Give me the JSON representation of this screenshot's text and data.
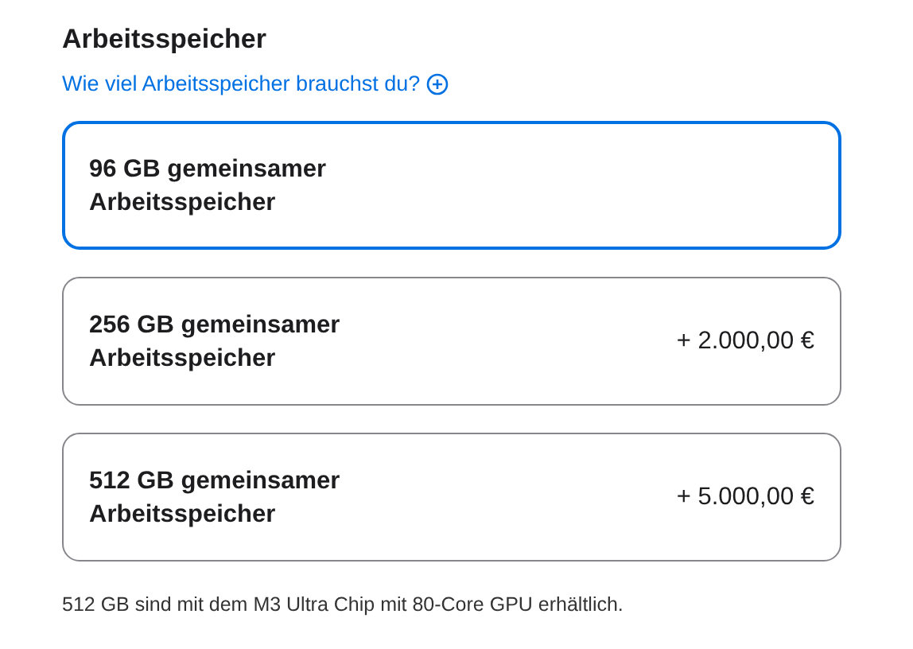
{
  "heading": "Arbeitsspeicher",
  "help_link": {
    "label": "Wie viel Arbeitsspeicher brauchst du?"
  },
  "options": [
    {
      "name": "96 GB gemeinsamer Arbeitsspeicher",
      "selected": true
    },
    {
      "name": "256 GB gemeinsamer Arbeitsspeicher",
      "price": "+ 2.000,00 €",
      "selected": false
    },
    {
      "name": "512 GB gemeinsamer Arbeitsspeicher",
      "price": "+ 5.000,00 €",
      "selected": false
    }
  ],
  "footnote": "512 GB sind mit dem M3 Ultra Chip mit 80-Core GPU erhältlich."
}
